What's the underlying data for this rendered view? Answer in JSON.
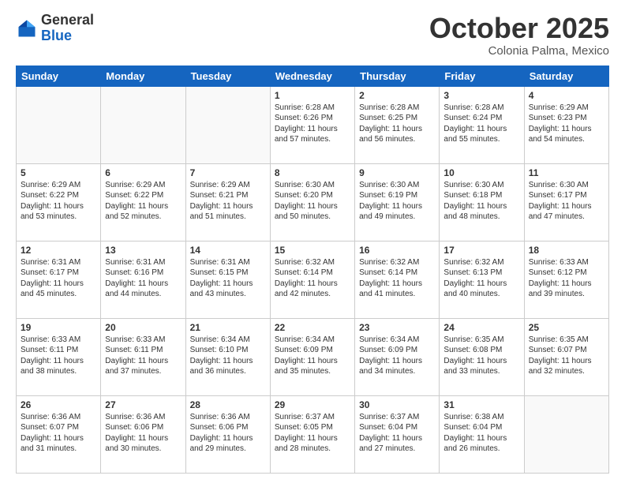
{
  "header": {
    "logo_general": "General",
    "logo_blue": "Blue",
    "month_title": "October 2025",
    "location": "Colonia Palma, Mexico"
  },
  "days_of_week": [
    "Sunday",
    "Monday",
    "Tuesday",
    "Wednesday",
    "Thursday",
    "Friday",
    "Saturday"
  ],
  "weeks": [
    [
      {
        "day": "",
        "info": ""
      },
      {
        "day": "",
        "info": ""
      },
      {
        "day": "",
        "info": ""
      },
      {
        "day": "1",
        "info": "Sunrise: 6:28 AM\nSunset: 6:26 PM\nDaylight: 11 hours\nand 57 minutes."
      },
      {
        "day": "2",
        "info": "Sunrise: 6:28 AM\nSunset: 6:25 PM\nDaylight: 11 hours\nand 56 minutes."
      },
      {
        "day": "3",
        "info": "Sunrise: 6:28 AM\nSunset: 6:24 PM\nDaylight: 11 hours\nand 55 minutes."
      },
      {
        "day": "4",
        "info": "Sunrise: 6:29 AM\nSunset: 6:23 PM\nDaylight: 11 hours\nand 54 minutes."
      }
    ],
    [
      {
        "day": "5",
        "info": "Sunrise: 6:29 AM\nSunset: 6:22 PM\nDaylight: 11 hours\nand 53 minutes."
      },
      {
        "day": "6",
        "info": "Sunrise: 6:29 AM\nSunset: 6:22 PM\nDaylight: 11 hours\nand 52 minutes."
      },
      {
        "day": "7",
        "info": "Sunrise: 6:29 AM\nSunset: 6:21 PM\nDaylight: 11 hours\nand 51 minutes."
      },
      {
        "day": "8",
        "info": "Sunrise: 6:30 AM\nSunset: 6:20 PM\nDaylight: 11 hours\nand 50 minutes."
      },
      {
        "day": "9",
        "info": "Sunrise: 6:30 AM\nSunset: 6:19 PM\nDaylight: 11 hours\nand 49 minutes."
      },
      {
        "day": "10",
        "info": "Sunrise: 6:30 AM\nSunset: 6:18 PM\nDaylight: 11 hours\nand 48 minutes."
      },
      {
        "day": "11",
        "info": "Sunrise: 6:30 AM\nSunset: 6:17 PM\nDaylight: 11 hours\nand 47 minutes."
      }
    ],
    [
      {
        "day": "12",
        "info": "Sunrise: 6:31 AM\nSunset: 6:17 PM\nDaylight: 11 hours\nand 45 minutes."
      },
      {
        "day": "13",
        "info": "Sunrise: 6:31 AM\nSunset: 6:16 PM\nDaylight: 11 hours\nand 44 minutes."
      },
      {
        "day": "14",
        "info": "Sunrise: 6:31 AM\nSunset: 6:15 PM\nDaylight: 11 hours\nand 43 minutes."
      },
      {
        "day": "15",
        "info": "Sunrise: 6:32 AM\nSunset: 6:14 PM\nDaylight: 11 hours\nand 42 minutes."
      },
      {
        "day": "16",
        "info": "Sunrise: 6:32 AM\nSunset: 6:14 PM\nDaylight: 11 hours\nand 41 minutes."
      },
      {
        "day": "17",
        "info": "Sunrise: 6:32 AM\nSunset: 6:13 PM\nDaylight: 11 hours\nand 40 minutes."
      },
      {
        "day": "18",
        "info": "Sunrise: 6:33 AM\nSunset: 6:12 PM\nDaylight: 11 hours\nand 39 minutes."
      }
    ],
    [
      {
        "day": "19",
        "info": "Sunrise: 6:33 AM\nSunset: 6:11 PM\nDaylight: 11 hours\nand 38 minutes."
      },
      {
        "day": "20",
        "info": "Sunrise: 6:33 AM\nSunset: 6:11 PM\nDaylight: 11 hours\nand 37 minutes."
      },
      {
        "day": "21",
        "info": "Sunrise: 6:34 AM\nSunset: 6:10 PM\nDaylight: 11 hours\nand 36 minutes."
      },
      {
        "day": "22",
        "info": "Sunrise: 6:34 AM\nSunset: 6:09 PM\nDaylight: 11 hours\nand 35 minutes."
      },
      {
        "day": "23",
        "info": "Sunrise: 6:34 AM\nSunset: 6:09 PM\nDaylight: 11 hours\nand 34 minutes."
      },
      {
        "day": "24",
        "info": "Sunrise: 6:35 AM\nSunset: 6:08 PM\nDaylight: 11 hours\nand 33 minutes."
      },
      {
        "day": "25",
        "info": "Sunrise: 6:35 AM\nSunset: 6:07 PM\nDaylight: 11 hours\nand 32 minutes."
      }
    ],
    [
      {
        "day": "26",
        "info": "Sunrise: 6:36 AM\nSunset: 6:07 PM\nDaylight: 11 hours\nand 31 minutes."
      },
      {
        "day": "27",
        "info": "Sunrise: 6:36 AM\nSunset: 6:06 PM\nDaylight: 11 hours\nand 30 minutes."
      },
      {
        "day": "28",
        "info": "Sunrise: 6:36 AM\nSunset: 6:06 PM\nDaylight: 11 hours\nand 29 minutes."
      },
      {
        "day": "29",
        "info": "Sunrise: 6:37 AM\nSunset: 6:05 PM\nDaylight: 11 hours\nand 28 minutes."
      },
      {
        "day": "30",
        "info": "Sunrise: 6:37 AM\nSunset: 6:04 PM\nDaylight: 11 hours\nand 27 minutes."
      },
      {
        "day": "31",
        "info": "Sunrise: 6:38 AM\nSunset: 6:04 PM\nDaylight: 11 hours\nand 26 minutes."
      },
      {
        "day": "",
        "info": ""
      }
    ]
  ]
}
